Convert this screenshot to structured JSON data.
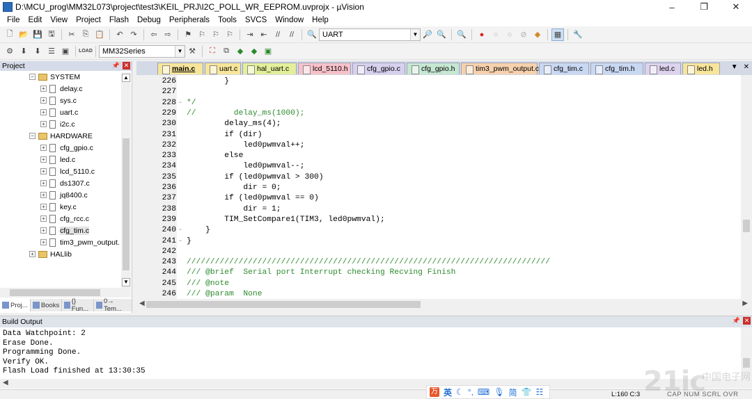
{
  "window": {
    "title": "D:\\MCU_prog\\MM32L073\\project\\test3\\KEIL_PRJ\\I2C_POLL_WR_EEPROM.uvprojx - µVision",
    "minimize": "–",
    "maximize": "❐",
    "close": "✕"
  },
  "menu": [
    "File",
    "Edit",
    "View",
    "Project",
    "Flash",
    "Debug",
    "Peripherals",
    "Tools",
    "SVCS",
    "Window",
    "Help"
  ],
  "toolbar": {
    "find_combo": "UART",
    "target_combo": "MM32Series",
    "load_label": "LOAD"
  },
  "project_pane": {
    "title": "Project",
    "tree": [
      {
        "label": "SYSTEM",
        "kind": "folder"
      },
      {
        "label": "delay.c",
        "kind": "file"
      },
      {
        "label": "sys.c",
        "kind": "file"
      },
      {
        "label": "uart.c",
        "kind": "file"
      },
      {
        "label": "i2c.c",
        "kind": "file"
      },
      {
        "label": "HARDWARE",
        "kind": "folder"
      },
      {
        "label": "cfg_gpio.c",
        "kind": "file"
      },
      {
        "label": "led.c",
        "kind": "file"
      },
      {
        "label": "lcd_5110.c",
        "kind": "file"
      },
      {
        "label": "ds1307.c",
        "kind": "file"
      },
      {
        "label": "jq8400.c",
        "kind": "file"
      },
      {
        "label": "key.c",
        "kind": "file"
      },
      {
        "label": "cfg_rcc.c",
        "kind": "file"
      },
      {
        "label": "cfg_tim.c",
        "kind": "file"
      },
      {
        "label": "tim3_pwm_output.",
        "kind": "file"
      },
      {
        "label": "HALlib",
        "kind": "folder"
      }
    ],
    "tabs": [
      "Proj...",
      "Books",
      "{} Fun...",
      "0→ Tem..."
    ]
  },
  "file_tabs": [
    {
      "label": "main.c",
      "color": "#f7e59a"
    },
    {
      "label": "uart.c",
      "color": "#f7e59a"
    },
    {
      "label": "hal_uart.c",
      "color": "#e4ef9a"
    },
    {
      "label": "lcd_5110.h",
      "color": "#f7c1c9"
    },
    {
      "label": "cfg_gpio.c",
      "color": "#d7d0ee"
    },
    {
      "label": "cfg_gpio.h",
      "color": "#c6e7d2"
    },
    {
      "label": "tim3_pwm_output.c",
      "color": "#f7d1ad"
    },
    {
      "label": "cfg_tim.c",
      "color": "#c9d8f2"
    },
    {
      "label": "cfg_tim.h",
      "color": "#c9d8f2"
    },
    {
      "label": "led.c",
      "color": "#ded3ee"
    },
    {
      "label": "led.h",
      "color": "#f7e59a"
    }
  ],
  "code_lines": [
    {
      "n": "226",
      "text": "        }",
      "comment": false,
      "fold": ""
    },
    {
      "n": "227",
      "text": "",
      "comment": false,
      "fold": ""
    },
    {
      "n": "228",
      "text": "*/",
      "comment": true,
      "fold": "-"
    },
    {
      "n": "229",
      "text": "//        delay_ms(1000);",
      "comment": true,
      "fold": ""
    },
    {
      "n": "230",
      "text": "        delay_ms(4);",
      "comment": false,
      "fold": ""
    },
    {
      "n": "231",
      "text": "        if (dir)",
      "comment": false,
      "fold": ""
    },
    {
      "n": "232",
      "text": "            led0pwmval++;",
      "comment": false,
      "fold": ""
    },
    {
      "n": "233",
      "text": "        else",
      "comment": false,
      "fold": ""
    },
    {
      "n": "234",
      "text": "            led0pwmval--;",
      "comment": false,
      "fold": ""
    },
    {
      "n": "235",
      "text": "        if (led0pwmval > 300)",
      "comment": false,
      "fold": ""
    },
    {
      "n": "236",
      "text": "            dir = 0;",
      "comment": false,
      "fold": ""
    },
    {
      "n": "237",
      "text": "        if (led0pwmval == 0)",
      "comment": false,
      "fold": ""
    },
    {
      "n": "238",
      "text": "            dir = 1;",
      "comment": false,
      "fold": ""
    },
    {
      "n": "239",
      "text": "        TIM_SetCompare1(TIM3, led0pwmval);",
      "comment": false,
      "fold": ""
    },
    {
      "n": "240",
      "text": "    }",
      "comment": false,
      "fold": "-"
    },
    {
      "n": "241",
      "text": "}",
      "comment": false,
      "fold": "-"
    },
    {
      "n": "242",
      "text": "",
      "comment": false,
      "fold": ""
    },
    {
      "n": "243",
      "text": "/////////////////////////////////////////////////////////////////////////////",
      "comment": true,
      "fold": ""
    },
    {
      "n": "244",
      "text": "/// @brief  Serial port Interrupt checking Recving Finish",
      "comment": true,
      "fold": ""
    },
    {
      "n": "245",
      "text": "/// @note",
      "comment": true,
      "fold": ""
    },
    {
      "n": "246",
      "text": "/// @param  None",
      "comment": true,
      "fold": ""
    }
  ],
  "build_output": {
    "title": "Build Output",
    "lines": [
      "Data Watchpoint: 2",
      "Erase Done.",
      "Programming Done.",
      "Verify OK.",
      "Flash Load finished at 13:30:35"
    ]
  },
  "status": {
    "position": "L:160 C:3",
    "keys": "CAP  NUM  SCRL  OVR  R/W"
  },
  "ime": {
    "mode": "英"
  },
  "watermark": {
    "text": "21ic",
    "sub": "中国电子网"
  }
}
